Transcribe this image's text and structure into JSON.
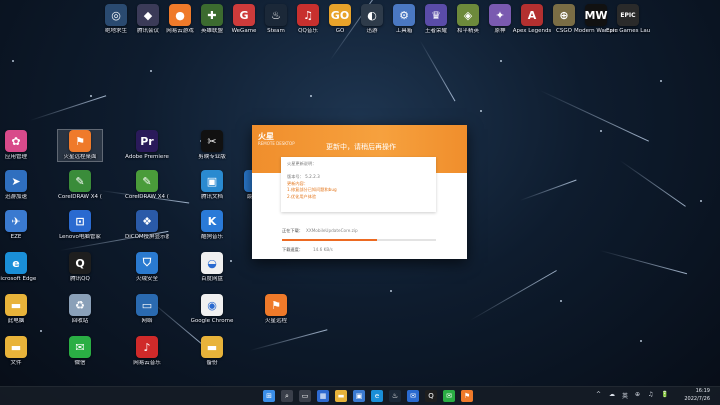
{
  "desktop": {
    "top_icons": [
      {
        "label": "绝地求生",
        "color": "#2a4a70",
        "glyph": "◎"
      },
      {
        "label": "腾讯会议",
        "color": "#3b3b58",
        "glyph": "◆"
      },
      {
        "label": "网易云游戏",
        "color": "#ef7a2a",
        "glyph": "●"
      },
      {
        "label": "英雄联盟",
        "color": "#3c6b2f",
        "glyph": "✚"
      },
      {
        "label": "WeGame",
        "color": "#cd3b3b",
        "glyph": "G"
      },
      {
        "label": "Steam",
        "color": "#1b2838",
        "glyph": "♨"
      },
      {
        "label": "QQ音乐",
        "color": "#c8302e",
        "glyph": "♫"
      },
      {
        "label": "GO",
        "color": "#e8a32a",
        "glyph": "GO"
      },
      {
        "label": "迅游",
        "color": "#2e3b4a",
        "glyph": "◐"
      },
      {
        "label": "工具箱",
        "color": "#4a78c2",
        "glyph": "⚙"
      },
      {
        "label": "王者荣耀",
        "color": "#5a4ca8",
        "glyph": "♛"
      },
      {
        "label": "和平精英",
        "color": "#6d8a3b",
        "glyph": "◈"
      },
      {
        "label": "原神",
        "color": "#7a5ab0",
        "glyph": "✦"
      },
      {
        "label": "Apex Legends",
        "color": "#b33030",
        "glyph": "A"
      },
      {
        "label": "CSGO",
        "color": "#7a6d45",
        "glyph": "⊕"
      },
      {
        "label": "Modern Warfare",
        "color": "#111111",
        "glyph": "MW"
      },
      {
        "label": "Epic Games Launcher",
        "color": "#2a2a2a",
        "glyph": "EPIC"
      }
    ],
    "left_icons": [
      {
        "label": "应用管理",
        "color": "#d84a8a",
        "glyph": "✿"
      },
      {
        "label": "迅游加速",
        "color": "#2f6fbf",
        "glyph": "➤"
      },
      {
        "label": "EZE",
        "color": "#3a7ad0",
        "glyph": "✈"
      },
      {
        "label": "Microsoft Edge",
        "color": "#1a8fd8",
        "glyph": "e"
      },
      {
        "label": "此电脑",
        "color": "#e8b33a",
        "glyph": "▬"
      },
      {
        "label": "文件",
        "color": "#e8b33a",
        "glyph": "▬"
      }
    ],
    "col2_icons": [
      {
        "label": "火星远程桌面",
        "color": "#ef7a2a",
        "glyph": "⚑",
        "selected": true
      },
      {
        "label": "CorelDRAW X4 (32位) 精...",
        "color": "#3a8c3a",
        "glyph": "✎"
      },
      {
        "label": "Lenovo电脑管家",
        "color": "#2a6ad0",
        "glyph": "⊡"
      },
      {
        "label": "腾讯QQ",
        "color": "#1e1e1e",
        "glyph": "Q"
      },
      {
        "label": "回收站",
        "color": "#8aa0b8",
        "glyph": "♻"
      },
      {
        "label": "微信",
        "color": "#2aae44",
        "glyph": "✉"
      }
    ],
    "col3_icons": [
      {
        "label": "Adobe Premiere",
        "color": "#2a1a5a",
        "glyph": "Pr"
      },
      {
        "label": "CorelDRAW X4 (32位)",
        "color": "#4a9c3a",
        "glyph": "✎"
      },
      {
        "label": "DiCOM投屏显示器",
        "color": "#2a5aa8",
        "glyph": "❖"
      },
      {
        "label": "火绒安全",
        "color": "#2a7ad0",
        "glyph": "⛉"
      },
      {
        "label": "网络",
        "color": "#2a6ab0",
        "glyph": "▭"
      },
      {
        "label": "网易云音乐",
        "color": "#d02a2a",
        "glyph": "♪"
      }
    ],
    "col4_icons": [
      {
        "label": "剪映专业版",
        "color": "#111111",
        "glyph": "✂"
      },
      {
        "label": "腾讯文档",
        "color": "#2a8ad0",
        "glyph": "▣"
      },
      {
        "label": "酷狗音乐",
        "color": "#2a7ad8",
        "glyph": "K"
      },
      {
        "label": "百度网盘",
        "color": "#f0f0f0",
        "glyph": "◒"
      },
      {
        "label": "Google Chrome",
        "color": "#f0f0f0",
        "glyph": "◉"
      },
      {
        "label": "备份",
        "color": "#e8b33a",
        "glyph": "▬"
      }
    ],
    "col5_icons": [
      {
        "label": "最新版",
        "color": "#2a7ad0",
        "glyph": "⬆"
      },
      {
        "label": "火星远程",
        "color": "#ef7a2a",
        "glyph": "⚑"
      }
    ]
  },
  "installer": {
    "logo": "火星",
    "logo_sub": "REMOTE DESKTOP",
    "title": "更新中，请稍后再操作",
    "notes": [
      {
        "text": "火星更新说明：",
        "hl": false
      },
      {
        "text": "",
        "hl": false
      },
      {
        "text": "版本号：  5.2.2.3",
        "hl": false
      },
      {
        "text": "更新内容：",
        "hl": true
      },
      {
        "text": "1.修复部分已知问题和bug",
        "hl": true
      },
      {
        "text": "2.优化用户体验",
        "hl": true
      }
    ],
    "progress_label": "正在下载：",
    "progress_file": "XXMobileUpdateCore.zip",
    "progress": 0.62,
    "speed_label": "下载速度：",
    "speed_value": "14.6 KB/s"
  },
  "taskbar": {
    "apps": [
      {
        "name": "start",
        "color": "#3a8ee8",
        "glyph": "⊞"
      },
      {
        "name": "search",
        "color": "#3a3f4a",
        "glyph": "⌕"
      },
      {
        "name": "task-view",
        "color": "#3a3f4a",
        "glyph": "▭"
      },
      {
        "name": "widgets",
        "color": "#2e6ad0",
        "glyph": "▦"
      },
      {
        "name": "file-explorer",
        "color": "#e8b33a",
        "glyph": "▬"
      },
      {
        "name": "microsoft-store",
        "color": "#3a7ad0",
        "glyph": "▣"
      },
      {
        "name": "edge",
        "color": "#1a8fd8",
        "glyph": "e"
      },
      {
        "name": "steam",
        "color": "#1b2838",
        "glyph": "♨"
      },
      {
        "name": "mail",
        "color": "#2a6ad0",
        "glyph": "✉"
      },
      {
        "name": "qq",
        "color": "#1e1e1e",
        "glyph": "Q"
      },
      {
        "name": "wechat",
        "color": "#2aae44",
        "glyph": "✉"
      },
      {
        "name": "mars-remote",
        "color": "#ef7a2a",
        "glyph": "⚑"
      }
    ],
    "tray": [
      "^",
      "☁",
      "英",
      "⊕",
      "♫",
      "🔋"
    ],
    "time": "16:19",
    "date": "2022/7/26"
  }
}
